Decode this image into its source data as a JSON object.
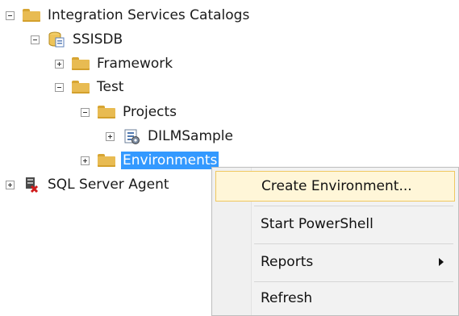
{
  "tree": {
    "integration_catalogs": "Integration Services Catalogs",
    "ssisdb": "SSISDB",
    "framework": "Framework",
    "test": "Test",
    "projects": "Projects",
    "dilmsample": "DILMSample",
    "environments": "Environments",
    "sql_agent": "SQL Server Agent"
  },
  "context_menu": {
    "create_environment": "Create Environment...",
    "start_powershell": "Start PowerShell",
    "reports": "Reports",
    "refresh": "Refresh"
  },
  "icons": {
    "folder": "folder-icon",
    "database": "database-icon",
    "package": "package-icon",
    "agent": "sql-agent-icon"
  },
  "colors": {
    "selection": "#3399ff",
    "menu_hover": "#fff6d8",
    "folder": "#e8bb52"
  }
}
